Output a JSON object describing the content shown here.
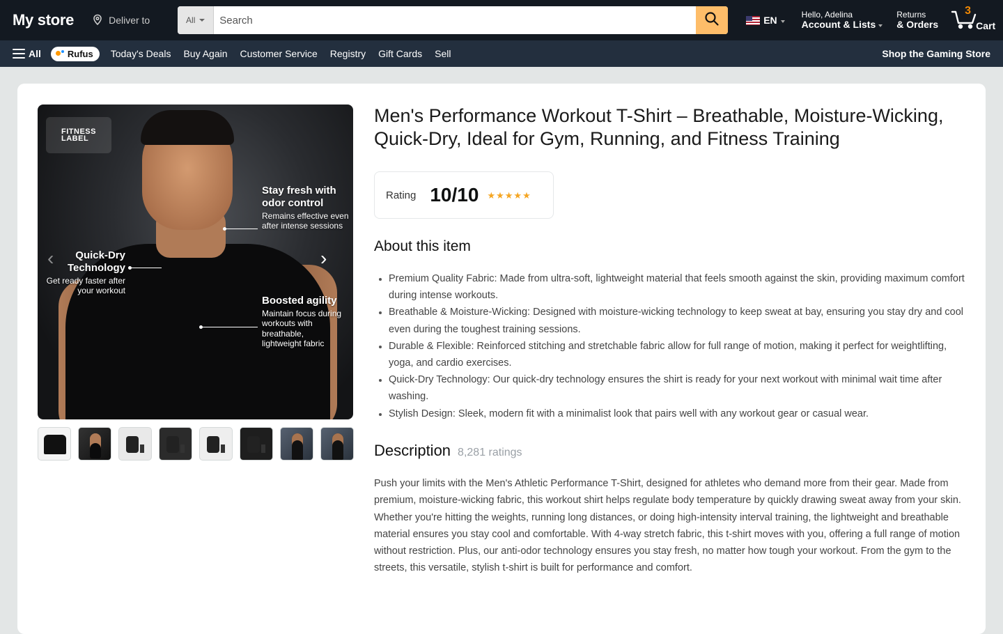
{
  "header": {
    "logo": "My store",
    "deliver_label": "Deliver to",
    "search_category": "All",
    "search_placeholder": "Search",
    "language": "EN",
    "greeting": "Hello, Adelina",
    "account_label": "Account & Lists",
    "returns_small": "Returns",
    "returns_big": "& Orders",
    "cart_count": "3",
    "cart_label": "Cart"
  },
  "subnav": {
    "all_label": "All",
    "rufus_label": "Rufus",
    "links": [
      "Today's Deals",
      "Buy Again",
      "Customer Service",
      "Registry",
      "Gift Cards",
      "Sell"
    ],
    "right_link": "Shop the Gaming Store"
  },
  "gallery": {
    "brand": "FITNESS\nLABEL",
    "callouts": [
      {
        "title": "Stay fresh with odor control",
        "desc": "Remains effective even after intense sessions"
      },
      {
        "title": "Quick-Dry Technology",
        "desc": "Get ready faster after your workout"
      },
      {
        "title": "Boosted agility",
        "desc": "Maintain focus during workouts with breathable, lightweight fabric"
      }
    ],
    "prev_icon": "chevron-left-icon",
    "next_icon": "chevron-right-icon",
    "thumbnail_count": 8
  },
  "product": {
    "title": "Men's Performance Workout T-Shirt – Breathable, Moisture-Wicking, Quick-Dry, Ideal for Gym, Running, and Fitness Training",
    "rating_label": "Rating",
    "rating_value": "10/10",
    "stars": 5,
    "about_title": "About this item",
    "bullets": [
      "Premium Quality Fabric: Made from ultra-soft, lightweight material that feels smooth against the skin, providing maximum comfort during intense workouts.",
      "Breathable & Moisture-Wicking: Designed with moisture-wicking technology to keep sweat at bay, ensuring you stay dry and cool even during the toughest training sessions.",
      "Durable & Flexible: Reinforced stitching and stretchable fabric allow for full range of motion, making it perfect for weightlifting, yoga, and cardio exercises.",
      "Quick-Dry Technology: Our quick-dry technology ensures the shirt is ready for your next workout with minimal wait time after washing.",
      "Stylish Design: Sleek, modern fit with a minimalist look that pairs well with any workout gear or casual wear."
    ],
    "description_title": "Description",
    "ratings_count": "8,281 ratings",
    "description": "Push your limits with the Men's Athletic Performance T-Shirt, designed for athletes who demand more from their gear. Made from premium, moisture-wicking fabric, this workout shirt helps regulate body temperature by quickly drawing sweat away from your skin. Whether you're hitting the weights, running long distances, or doing high-intensity interval training, the lightweight and breathable material ensures you stay cool and comfortable. With 4-way stretch fabric, this t-shirt moves with you, offering a full range of motion without restriction. Plus, our anti-odor technology ensures you stay fresh, no matter how tough your workout. From the gym to the streets, this versatile, stylish t-shirt is built for performance and comfort."
  },
  "colors": {
    "nav_bg": "#131921",
    "subnav_bg": "#232f3e",
    "search_button": "#febd69",
    "cart_count": "#f08804",
    "star": "#f5a623"
  }
}
